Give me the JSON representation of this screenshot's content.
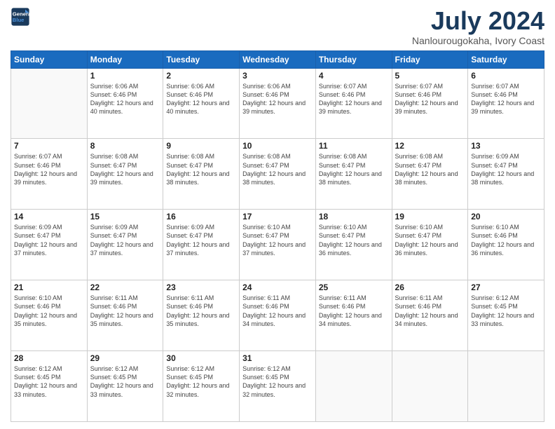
{
  "header": {
    "logo_line1": "General",
    "logo_line2": "Blue",
    "month": "July 2024",
    "location": "Nanlourougokaha, Ivory Coast"
  },
  "weekdays": [
    "Sunday",
    "Monday",
    "Tuesday",
    "Wednesday",
    "Thursday",
    "Friday",
    "Saturday"
  ],
  "weeks": [
    [
      {
        "day": "",
        "sunrise": "",
        "sunset": "",
        "daylight": ""
      },
      {
        "day": "1",
        "sunrise": "Sunrise: 6:06 AM",
        "sunset": "Sunset: 6:46 PM",
        "daylight": "Daylight: 12 hours and 40 minutes."
      },
      {
        "day": "2",
        "sunrise": "Sunrise: 6:06 AM",
        "sunset": "Sunset: 6:46 PM",
        "daylight": "Daylight: 12 hours and 40 minutes."
      },
      {
        "day": "3",
        "sunrise": "Sunrise: 6:06 AM",
        "sunset": "Sunset: 6:46 PM",
        "daylight": "Daylight: 12 hours and 39 minutes."
      },
      {
        "day": "4",
        "sunrise": "Sunrise: 6:07 AM",
        "sunset": "Sunset: 6:46 PM",
        "daylight": "Daylight: 12 hours and 39 minutes."
      },
      {
        "day": "5",
        "sunrise": "Sunrise: 6:07 AM",
        "sunset": "Sunset: 6:46 PM",
        "daylight": "Daylight: 12 hours and 39 minutes."
      },
      {
        "day": "6",
        "sunrise": "Sunrise: 6:07 AM",
        "sunset": "Sunset: 6:46 PM",
        "daylight": "Daylight: 12 hours and 39 minutes."
      }
    ],
    [
      {
        "day": "7",
        "sunrise": "Sunrise: 6:07 AM",
        "sunset": "Sunset: 6:46 PM",
        "daylight": "Daylight: 12 hours and 39 minutes."
      },
      {
        "day": "8",
        "sunrise": "Sunrise: 6:08 AM",
        "sunset": "Sunset: 6:47 PM",
        "daylight": "Daylight: 12 hours and 39 minutes."
      },
      {
        "day": "9",
        "sunrise": "Sunrise: 6:08 AM",
        "sunset": "Sunset: 6:47 PM",
        "daylight": "Daylight: 12 hours and 38 minutes."
      },
      {
        "day": "10",
        "sunrise": "Sunrise: 6:08 AM",
        "sunset": "Sunset: 6:47 PM",
        "daylight": "Daylight: 12 hours and 38 minutes."
      },
      {
        "day": "11",
        "sunrise": "Sunrise: 6:08 AM",
        "sunset": "Sunset: 6:47 PM",
        "daylight": "Daylight: 12 hours and 38 minutes."
      },
      {
        "day": "12",
        "sunrise": "Sunrise: 6:08 AM",
        "sunset": "Sunset: 6:47 PM",
        "daylight": "Daylight: 12 hours and 38 minutes."
      },
      {
        "day": "13",
        "sunrise": "Sunrise: 6:09 AM",
        "sunset": "Sunset: 6:47 PM",
        "daylight": "Daylight: 12 hours and 38 minutes."
      }
    ],
    [
      {
        "day": "14",
        "sunrise": "Sunrise: 6:09 AM",
        "sunset": "Sunset: 6:47 PM",
        "daylight": "Daylight: 12 hours and 37 minutes."
      },
      {
        "day": "15",
        "sunrise": "Sunrise: 6:09 AM",
        "sunset": "Sunset: 6:47 PM",
        "daylight": "Daylight: 12 hours and 37 minutes."
      },
      {
        "day": "16",
        "sunrise": "Sunrise: 6:09 AM",
        "sunset": "Sunset: 6:47 PM",
        "daylight": "Daylight: 12 hours and 37 minutes."
      },
      {
        "day": "17",
        "sunrise": "Sunrise: 6:10 AM",
        "sunset": "Sunset: 6:47 PM",
        "daylight": "Daylight: 12 hours and 37 minutes."
      },
      {
        "day": "18",
        "sunrise": "Sunrise: 6:10 AM",
        "sunset": "Sunset: 6:47 PM",
        "daylight": "Daylight: 12 hours and 36 minutes."
      },
      {
        "day": "19",
        "sunrise": "Sunrise: 6:10 AM",
        "sunset": "Sunset: 6:47 PM",
        "daylight": "Daylight: 12 hours and 36 minutes."
      },
      {
        "day": "20",
        "sunrise": "Sunrise: 6:10 AM",
        "sunset": "Sunset: 6:46 PM",
        "daylight": "Daylight: 12 hours and 36 minutes."
      }
    ],
    [
      {
        "day": "21",
        "sunrise": "Sunrise: 6:10 AM",
        "sunset": "Sunset: 6:46 PM",
        "daylight": "Daylight: 12 hours and 35 minutes."
      },
      {
        "day": "22",
        "sunrise": "Sunrise: 6:11 AM",
        "sunset": "Sunset: 6:46 PM",
        "daylight": "Daylight: 12 hours and 35 minutes."
      },
      {
        "day": "23",
        "sunrise": "Sunrise: 6:11 AM",
        "sunset": "Sunset: 6:46 PM",
        "daylight": "Daylight: 12 hours and 35 minutes."
      },
      {
        "day": "24",
        "sunrise": "Sunrise: 6:11 AM",
        "sunset": "Sunset: 6:46 PM",
        "daylight": "Daylight: 12 hours and 34 minutes."
      },
      {
        "day": "25",
        "sunrise": "Sunrise: 6:11 AM",
        "sunset": "Sunset: 6:46 PM",
        "daylight": "Daylight: 12 hours and 34 minutes."
      },
      {
        "day": "26",
        "sunrise": "Sunrise: 6:11 AM",
        "sunset": "Sunset: 6:46 PM",
        "daylight": "Daylight: 12 hours and 34 minutes."
      },
      {
        "day": "27",
        "sunrise": "Sunrise: 6:12 AM",
        "sunset": "Sunset: 6:45 PM",
        "daylight": "Daylight: 12 hours and 33 minutes."
      }
    ],
    [
      {
        "day": "28",
        "sunrise": "Sunrise: 6:12 AM",
        "sunset": "Sunset: 6:45 PM",
        "daylight": "Daylight: 12 hours and 33 minutes."
      },
      {
        "day": "29",
        "sunrise": "Sunrise: 6:12 AM",
        "sunset": "Sunset: 6:45 PM",
        "daylight": "Daylight: 12 hours and 33 minutes."
      },
      {
        "day": "30",
        "sunrise": "Sunrise: 6:12 AM",
        "sunset": "Sunset: 6:45 PM",
        "daylight": "Daylight: 12 hours and 32 minutes."
      },
      {
        "day": "31",
        "sunrise": "Sunrise: 6:12 AM",
        "sunset": "Sunset: 6:45 PM",
        "daylight": "Daylight: 12 hours and 32 minutes."
      },
      {
        "day": "",
        "sunrise": "",
        "sunset": "",
        "daylight": ""
      },
      {
        "day": "",
        "sunrise": "",
        "sunset": "",
        "daylight": ""
      },
      {
        "day": "",
        "sunrise": "",
        "sunset": "",
        "daylight": ""
      }
    ]
  ]
}
